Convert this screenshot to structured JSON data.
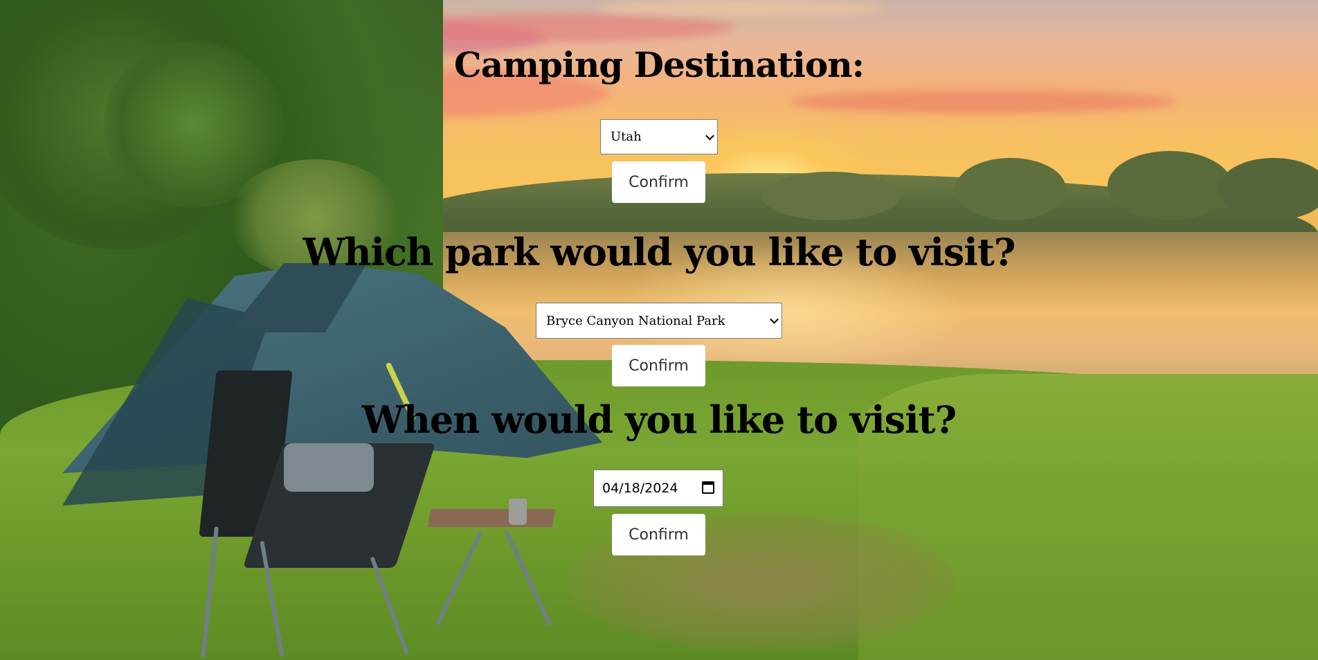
{
  "headings": {
    "destination": "Camping Destination:",
    "park": "Which park would you like to visit?",
    "when": "When would you like to visit?"
  },
  "destination_select": {
    "selected": "Utah",
    "icon": "chevron-down-icon"
  },
  "park_select": {
    "selected": "Bryce Canyon National Park",
    "icon": "chevron-down-icon"
  },
  "date_input": {
    "value": "04/18/2024",
    "icon": "calendar-icon"
  },
  "buttons": {
    "confirm_destination": "Confirm",
    "confirm_park": "Confirm",
    "confirm_date": "Confirm"
  },
  "background": {
    "description_icon": "camping-landscape-background"
  }
}
